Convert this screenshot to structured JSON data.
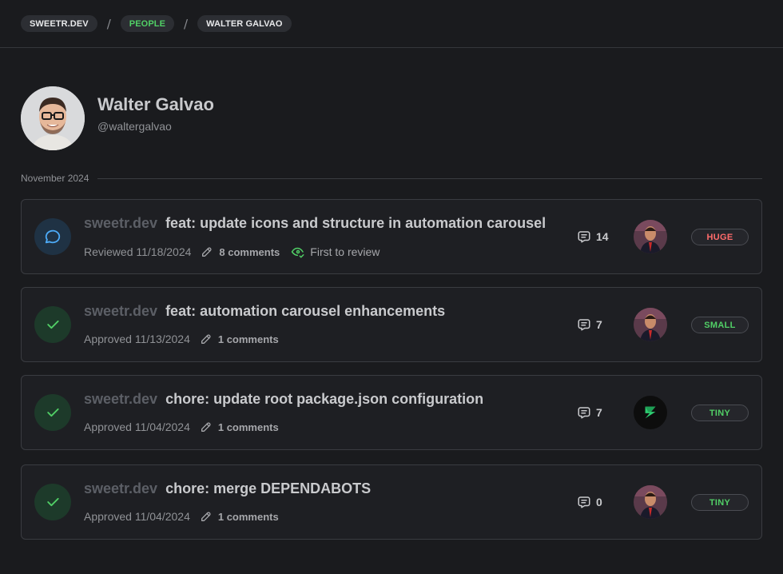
{
  "breadcrumb": [
    {
      "label": "SWEETR.DEV",
      "accent": false
    },
    {
      "label": "PEOPLE",
      "accent": true
    },
    {
      "label": "WALTER GALVAO",
      "accent": false
    }
  ],
  "breadcrumb_separator": "/",
  "profile": {
    "name": "Walter Galvao",
    "handle": "@waltergalvao"
  },
  "month_label": "November 2024",
  "colors": {
    "accent_green": "#51cf66",
    "accent_red": "#ff6b6b",
    "review_blue": "#4dabf7",
    "background": "#1a1b1e"
  },
  "pull_requests": [
    {
      "repo": "sweetr.dev",
      "title": "feat: update icons and structure in automation carousel",
      "status_icon": "message-circle-icon",
      "status_text": "Reviewed 11/18/2024",
      "comments_label": "8 comments",
      "first_review_label": "First to review",
      "comment_count": "14",
      "size": "HUGE"
    },
    {
      "repo": "sweetr.dev",
      "title": "feat: automation carousel enhancements",
      "status_icon": "check-icon",
      "status_text": "Approved 11/13/2024",
      "comments_label": "1 comments",
      "comment_count": "7",
      "size": "SMALL"
    },
    {
      "repo": "sweetr.dev",
      "title": "chore: update root package.json configuration",
      "status_icon": "check-icon",
      "status_text": "Approved 11/04/2024",
      "comments_label": "1 comments",
      "comment_count": "7",
      "size": "TINY"
    },
    {
      "repo": "sweetr.dev",
      "title": "chore: merge DEPENDABOTS",
      "status_icon": "check-icon",
      "status_text": "Approved 11/04/2024",
      "comments_label": "1 comments",
      "comment_count": "0",
      "size": "TINY"
    }
  ]
}
